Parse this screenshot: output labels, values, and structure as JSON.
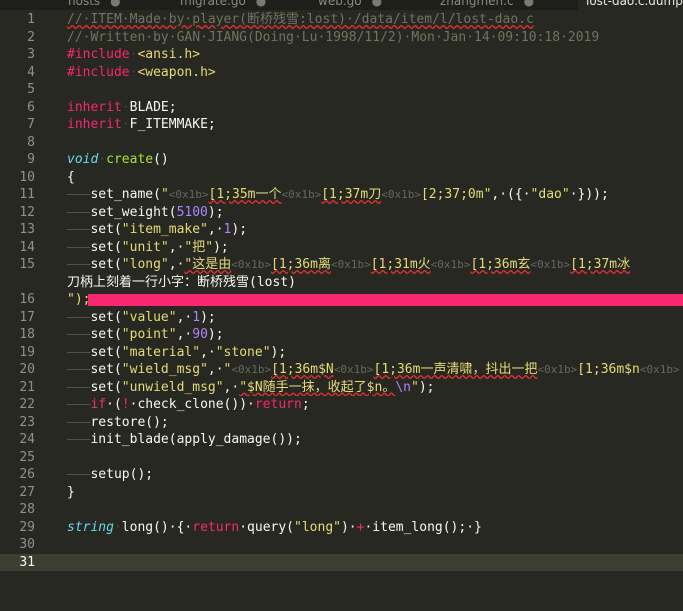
{
  "tabs": [
    {
      "label": "hosts",
      "close": "●",
      "active": false
    },
    {
      "label": "migrate.go",
      "close": "●",
      "active": false
    },
    {
      "label": "web.go",
      "close": "●",
      "active": false
    },
    {
      "label": "zhangmen.c",
      "close": "●",
      "active": false
    },
    {
      "label": "lost-dao.c.dump",
      "close": "",
      "active": true
    }
  ],
  "current_line": 31,
  "lines": [
    {
      "n": "1",
      "tokens": [
        {
          "t": "//·ITEM·Made·by·player(断桥残雪:lost)·/data/item/l/lost-dao.c",
          "c": "cm",
          "u": true
        }
      ]
    },
    {
      "n": "2",
      "tokens": [
        {
          "t": "//·Written·by·GAN·JIANG(Doing·Lu·1998/11/2)·Mon·Jan·14·09:10:18·2019",
          "c": "cm"
        }
      ]
    },
    {
      "n": "3",
      "tokens": [
        {
          "t": "#include",
          "c": "pp"
        },
        {
          "t": "·",
          "c": "ws"
        },
        {
          "t": "<ansi.h>",
          "c": "inc"
        }
      ]
    },
    {
      "n": "4",
      "tokens": [
        {
          "t": "#include",
          "c": "pp"
        },
        {
          "t": "·",
          "c": "ws"
        },
        {
          "t": "<weapon.h>",
          "c": "inc"
        }
      ]
    },
    {
      "n": "5",
      "tokens": []
    },
    {
      "n": "6",
      "tokens": [
        {
          "t": "inherit",
          "c": "kw"
        },
        {
          "t": "·",
          "c": "ws"
        },
        {
          "t": "BLADE;",
          "c": ""
        }
      ]
    },
    {
      "n": "7",
      "tokens": [
        {
          "t": "inherit",
          "c": "kw"
        },
        {
          "t": "·",
          "c": "ws"
        },
        {
          "t": "F_ITEMMAKE;",
          "c": ""
        }
      ]
    },
    {
      "n": "8",
      "tokens": []
    },
    {
      "n": "9",
      "tokens": [
        {
          "t": "void",
          "c": "ty"
        },
        {
          "t": "·",
          "c": "ws"
        },
        {
          "t": "create",
          "c": "fn"
        },
        {
          "t": "()",
          "c": ""
        }
      ]
    },
    {
      "n": "10",
      "tokens": [
        {
          "t": "{",
          "c": ""
        }
      ]
    },
    {
      "n": "11",
      "tokens": [
        {
          "t": "———",
          "c": "guide"
        },
        {
          "t": "set_name(",
          "c": ""
        },
        {
          "t": "\"",
          "c": "st"
        },
        {
          "t": "<0x1b>",
          "c": "esc"
        },
        {
          "t": "[1;35m一个",
          "c": "st",
          "u": true
        },
        {
          "t": "<0x1b>",
          "c": "esc"
        },
        {
          "t": "[1;37m刀",
          "c": "st",
          "u": true
        },
        {
          "t": "<0x1b>",
          "c": "esc"
        },
        {
          "t": "[2;37;0m\"",
          "c": "st"
        },
        {
          "t": ",·({·",
          "c": ""
        },
        {
          "t": "\"dao\"",
          "c": "st"
        },
        {
          "t": "·}));",
          "c": ""
        }
      ]
    },
    {
      "n": "12",
      "tokens": [
        {
          "t": "———",
          "c": "guide"
        },
        {
          "t": "set_weight(",
          "c": ""
        },
        {
          "t": "5100",
          "c": "nu"
        },
        {
          "t": ");",
          "c": ""
        }
      ]
    },
    {
      "n": "13",
      "tokens": [
        {
          "t": "———",
          "c": "guide"
        },
        {
          "t": "set(",
          "c": ""
        },
        {
          "t": "\"item_make\"",
          "c": "st"
        },
        {
          "t": ",·",
          "c": ""
        },
        {
          "t": "1",
          "c": "nu"
        },
        {
          "t": ");",
          "c": ""
        }
      ]
    },
    {
      "n": "14",
      "tokens": [
        {
          "t": "———",
          "c": "guide"
        },
        {
          "t": "set(",
          "c": ""
        },
        {
          "t": "\"unit\"",
          "c": "st"
        },
        {
          "t": ",·",
          "c": ""
        },
        {
          "t": "\"把\"",
          "c": "st"
        },
        {
          "t": ");",
          "c": ""
        }
      ]
    },
    {
      "n": "15",
      "tokens": [
        {
          "t": "———",
          "c": "guide"
        },
        {
          "t": "set(",
          "c": ""
        },
        {
          "t": "\"long\"",
          "c": "st"
        },
        {
          "t": ",·",
          "c": ""
        },
        {
          "t": "\"这是由",
          "c": "st",
          "u": true
        },
        {
          "t": "<0x1b>",
          "c": "esc"
        },
        {
          "t": "[1;36m离",
          "c": "st",
          "u": true
        },
        {
          "t": "<0x1b>",
          "c": "esc"
        },
        {
          "t": "[1;31m火",
          "c": "st",
          "u": true
        },
        {
          "t": "<0x1b>",
          "c": "esc"
        },
        {
          "t": "[1;36m玄",
          "c": "st",
          "u": true
        },
        {
          "t": "<0x1b>",
          "c": "esc"
        },
        {
          "t": "[1;37m冰",
          "c": "st",
          "u": true
        }
      ]
    },
    {
      "n": "",
      "tokens": [
        {
          "t": "刀柄上刻着一行小字：断桥残雪(lost)",
          "c": ""
        }
      ]
    },
    {
      "n": "16",
      "bar": true,
      "tokens": [
        {
          "t": "\");",
          "c": "st"
        }
      ]
    },
    {
      "n": "17",
      "tokens": [
        {
          "t": "———",
          "c": "guide"
        },
        {
          "t": "set(",
          "c": ""
        },
        {
          "t": "\"value\"",
          "c": "st"
        },
        {
          "t": ",·",
          "c": ""
        },
        {
          "t": "1",
          "c": "nu"
        },
        {
          "t": ");",
          "c": ""
        }
      ]
    },
    {
      "n": "18",
      "tokens": [
        {
          "t": "———",
          "c": "guide"
        },
        {
          "t": "set(",
          "c": ""
        },
        {
          "t": "\"point\"",
          "c": "st"
        },
        {
          "t": ",·",
          "c": ""
        },
        {
          "t": "90",
          "c": "nu"
        },
        {
          "t": ");",
          "c": ""
        }
      ]
    },
    {
      "n": "19",
      "tokens": [
        {
          "t": "———",
          "c": "guide"
        },
        {
          "t": "set(",
          "c": ""
        },
        {
          "t": "\"material\"",
          "c": "st"
        },
        {
          "t": ",·",
          "c": ""
        },
        {
          "t": "\"stone\"",
          "c": "st"
        },
        {
          "t": ");",
          "c": ""
        }
      ]
    },
    {
      "n": "20",
      "tokens": [
        {
          "t": "———",
          "c": "guide"
        },
        {
          "t": "set(",
          "c": ""
        },
        {
          "t": "\"wield_msg\"",
          "c": "st"
        },
        {
          "t": ",·",
          "c": ""
        },
        {
          "t": "\"",
          "c": "st"
        },
        {
          "t": "<0x1b>",
          "c": "esc"
        },
        {
          "t": "[1;36m$N",
          "c": "st",
          "u": true
        },
        {
          "t": "<0x1b>",
          "c": "esc"
        },
        {
          "t": "[1;36m一声清啸，抖出一把",
          "c": "st",
          "u": true
        },
        {
          "t": "<0x1b>",
          "c": "esc"
        },
        {
          "t": "[1;36m$n",
          "c": "st"
        },
        {
          "t": "<0x1b>",
          "c": "esc"
        }
      ]
    },
    {
      "n": "21",
      "tokens": [
        {
          "t": "———",
          "c": "guide"
        },
        {
          "t": "set(",
          "c": ""
        },
        {
          "t": "\"unwield_msg\"",
          "c": "st"
        },
        {
          "t": ",·",
          "c": ""
        },
        {
          "t": "\"$N随手一抹，收起了$n。",
          "c": "st",
          "u": true
        },
        {
          "t": "\\n",
          "c": "nu"
        },
        {
          "t": "\"",
          "c": "st"
        },
        {
          "t": ");",
          "c": ""
        }
      ]
    },
    {
      "n": "22",
      "tokens": [
        {
          "t": "———",
          "c": "guide"
        },
        {
          "t": "if",
          "c": "kw"
        },
        {
          "t": "·(",
          "c": ""
        },
        {
          "t": "!",
          "c": "kw"
        },
        {
          "t": "·check_clone())·",
          "c": ""
        },
        {
          "t": "return",
          "c": "kw"
        },
        {
          "t": ";",
          "c": ""
        }
      ]
    },
    {
      "n": "23",
      "tokens": [
        {
          "t": "———",
          "c": "guide"
        },
        {
          "t": "restore();",
          "c": ""
        }
      ]
    },
    {
      "n": "24",
      "tokens": [
        {
          "t": "———",
          "c": "guide"
        },
        {
          "t": "init_blade(apply_damage());",
          "c": ""
        }
      ]
    },
    {
      "n": "25",
      "tokens": []
    },
    {
      "n": "26",
      "tokens": [
        {
          "t": "———",
          "c": "guide"
        },
        {
          "t": "setup();",
          "c": ""
        }
      ]
    },
    {
      "n": "27",
      "tokens": [
        {
          "t": "}",
          "c": ""
        }
      ]
    },
    {
      "n": "28",
      "tokens": []
    },
    {
      "n": "29",
      "tokens": [
        {
          "t": "string",
          "c": "ty"
        },
        {
          "t": "·",
          "c": "ws"
        },
        {
          "t": "long()·{·",
          "c": ""
        },
        {
          "t": "return",
          "c": "kw"
        },
        {
          "t": "·query(",
          "c": ""
        },
        {
          "t": "\"long\"",
          "c": "st"
        },
        {
          "t": ")·",
          "c": ""
        },
        {
          "t": "+",
          "c": "kw"
        },
        {
          "t": "·item_long();·}",
          "c": ""
        }
      ]
    },
    {
      "n": "30",
      "tokens": []
    },
    {
      "n": "31",
      "tokens": []
    }
  ]
}
